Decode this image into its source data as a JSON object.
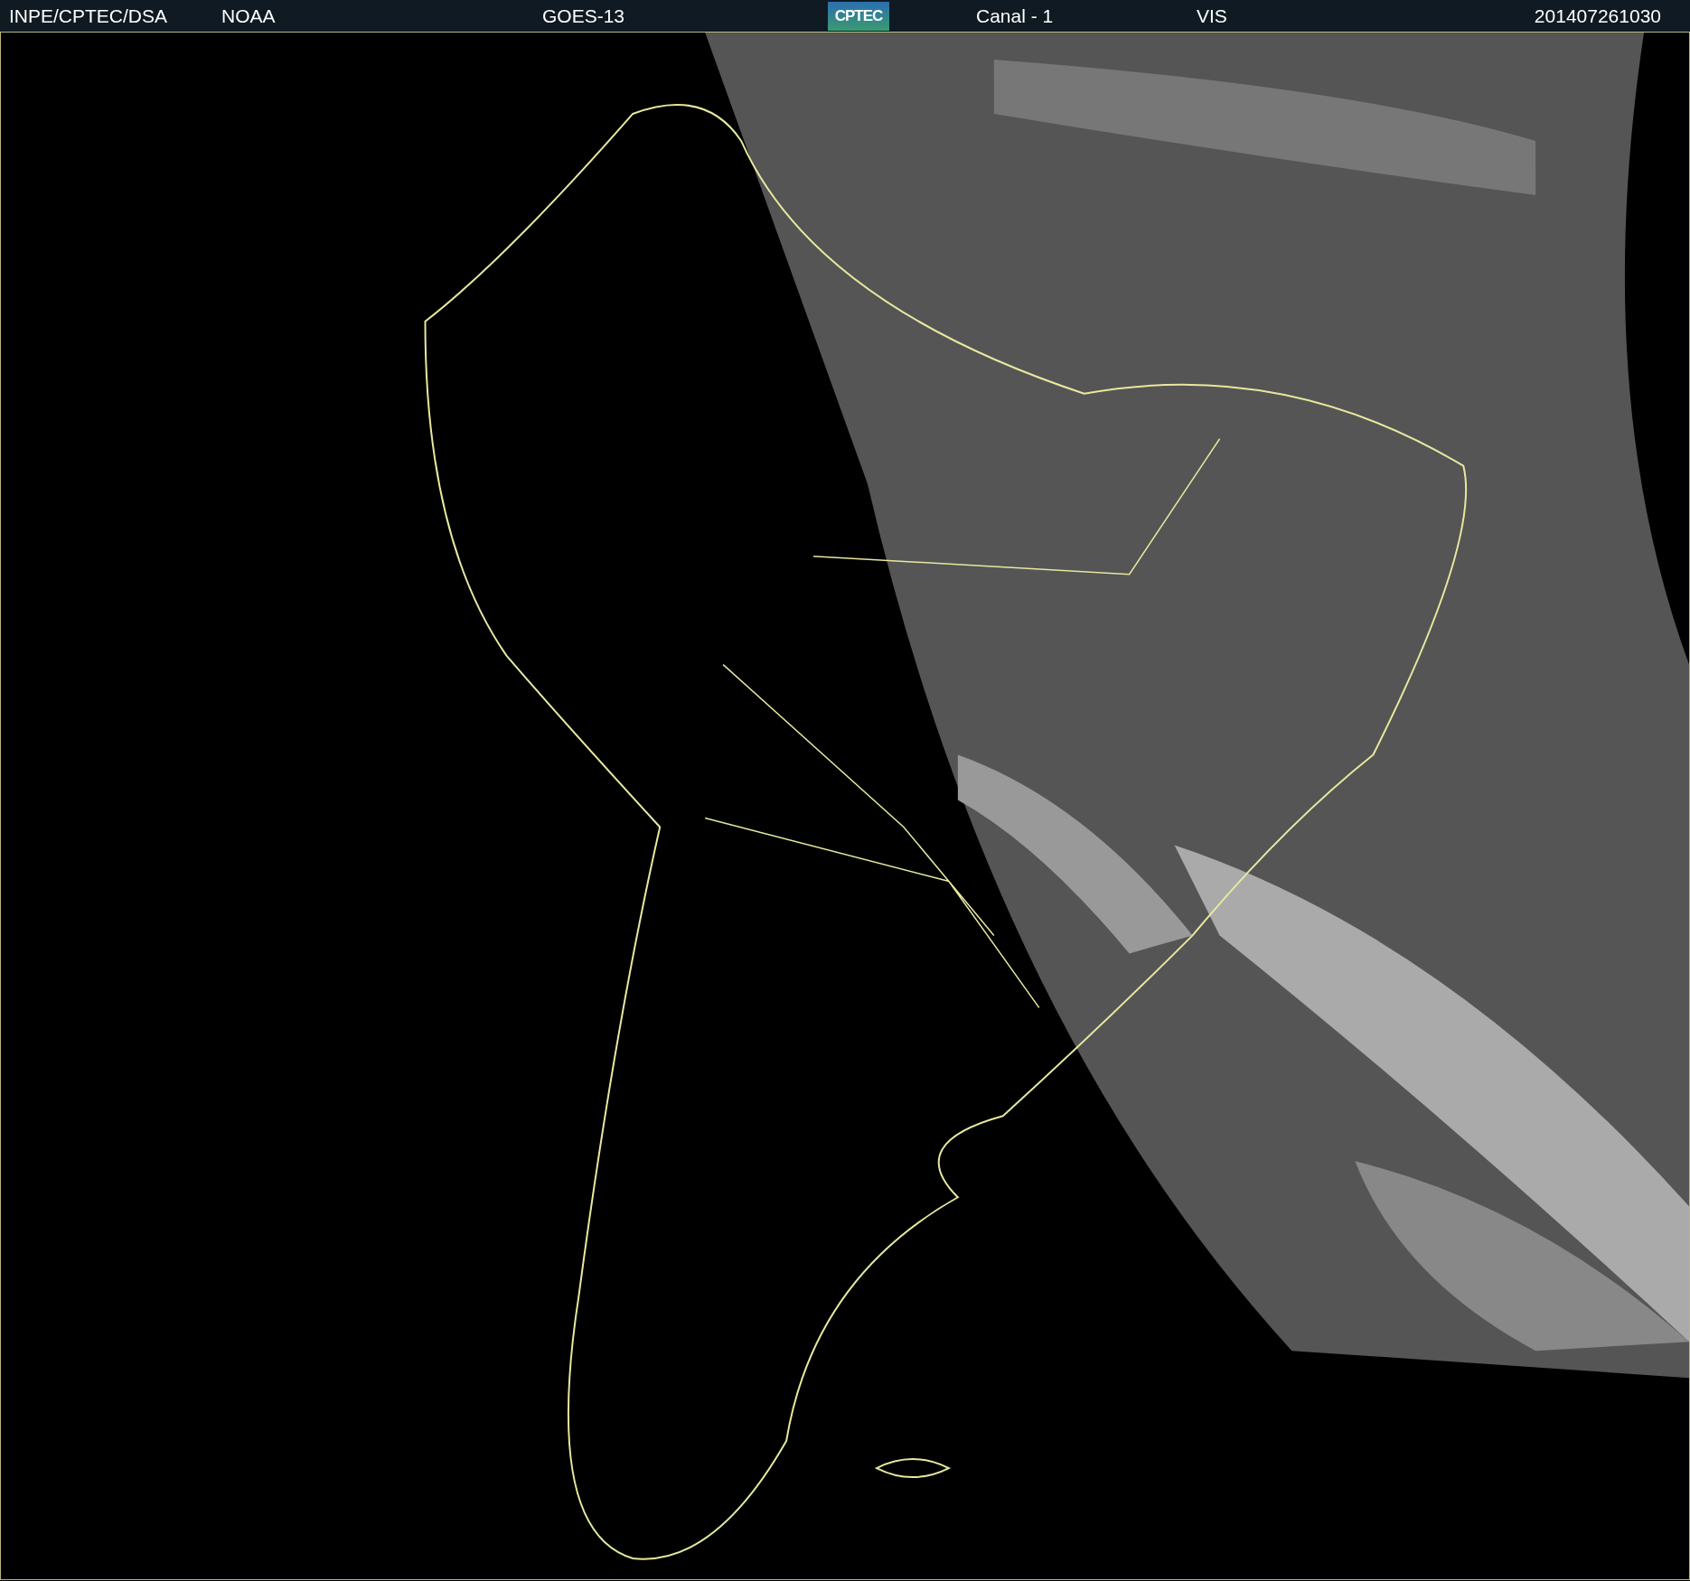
{
  "header": {
    "items": [
      {
        "kind": "text",
        "text": "INPE/CPTEC/DSA"
      },
      {
        "kind": "text",
        "text": "NOAA"
      },
      {
        "kind": "text",
        "text": "GOES-13"
      },
      {
        "kind": "logo",
        "text": "CPTEC"
      },
      {
        "kind": "text",
        "text": "Canal - 1"
      },
      {
        "kind": "text",
        "text": "VIS"
      },
      {
        "kind": "text",
        "text": "201407261030"
      }
    ]
  }
}
